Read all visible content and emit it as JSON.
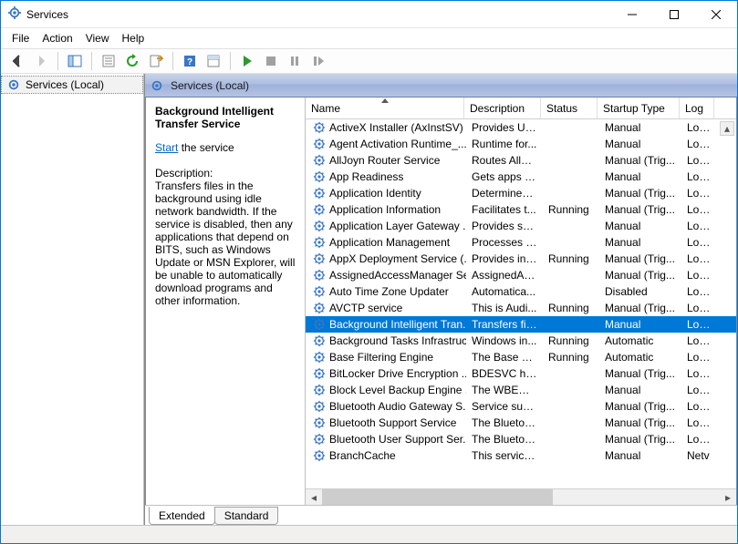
{
  "window": {
    "title": "Services"
  },
  "menu": [
    "File",
    "Action",
    "View",
    "Help"
  ],
  "tree": {
    "node": "Services (Local)"
  },
  "pane": {
    "title": "Services (Local)"
  },
  "detail": {
    "name": "Background Intelligent Transfer Service",
    "action_link": "Start",
    "action_suffix": " the service",
    "description_label": "Description:",
    "description": "Transfers files in the background using idle network bandwidth. If the service is disabled, then any applications that depend on BITS, such as Windows Update or MSN Explorer, will be unable to automatically download programs and other information."
  },
  "columns": [
    "Name",
    "Description",
    "Status",
    "Startup Type",
    "Log"
  ],
  "tabs": [
    "Extended",
    "Standard"
  ],
  "selected_index": 12,
  "services": [
    {
      "name": "ActiveX Installer (AxInstSV)",
      "desc": "Provides Us...",
      "status": "",
      "startup": "Manual",
      "logon": "Loca"
    },
    {
      "name": "Agent Activation Runtime_...",
      "desc": "Runtime for...",
      "status": "",
      "startup": "Manual",
      "logon": "Loca"
    },
    {
      "name": "AllJoyn Router Service",
      "desc": "Routes AllJo...",
      "status": "",
      "startup": "Manual (Trig...",
      "logon": "Loca"
    },
    {
      "name": "App Readiness",
      "desc": "Gets apps re...",
      "status": "",
      "startup": "Manual",
      "logon": "Loca"
    },
    {
      "name": "Application Identity",
      "desc": "Determines ...",
      "status": "",
      "startup": "Manual (Trig...",
      "logon": "Loca"
    },
    {
      "name": "Application Information",
      "desc": "Facilitates t...",
      "status": "Running",
      "startup": "Manual (Trig...",
      "logon": "Loca"
    },
    {
      "name": "Application Layer Gateway ...",
      "desc": "Provides su...",
      "status": "",
      "startup": "Manual",
      "logon": "Loca"
    },
    {
      "name": "Application Management",
      "desc": "Processes in...",
      "status": "",
      "startup": "Manual",
      "logon": "Loca"
    },
    {
      "name": "AppX Deployment Service (...",
      "desc": "Provides inf...",
      "status": "Running",
      "startup": "Manual (Trig...",
      "logon": "Loca"
    },
    {
      "name": "AssignedAccessManager Se...",
      "desc": "AssignedAc...",
      "status": "",
      "startup": "Manual (Trig...",
      "logon": "Loca"
    },
    {
      "name": "Auto Time Zone Updater",
      "desc": "Automatica...",
      "status": "",
      "startup": "Disabled",
      "logon": "Loca"
    },
    {
      "name": "AVCTP service",
      "desc": "This is Audi...",
      "status": "Running",
      "startup": "Manual (Trig...",
      "logon": "Loca"
    },
    {
      "name": "Background Intelligent Tran...",
      "desc": "Transfers fil...",
      "status": "",
      "startup": "Manual",
      "logon": "Loca"
    },
    {
      "name": "Background Tasks Infrastruc...",
      "desc": "Windows in...",
      "status": "Running",
      "startup": "Automatic",
      "logon": "Loca"
    },
    {
      "name": "Base Filtering Engine",
      "desc": "The Base Fil...",
      "status": "Running",
      "startup": "Automatic",
      "logon": "Loca"
    },
    {
      "name": "BitLocker Drive Encryption ...",
      "desc": "BDESVC hos...",
      "status": "",
      "startup": "Manual (Trig...",
      "logon": "Loca"
    },
    {
      "name": "Block Level Backup Engine ...",
      "desc": "The WBENG...",
      "status": "",
      "startup": "Manual",
      "logon": "Loca"
    },
    {
      "name": "Bluetooth Audio Gateway S...",
      "desc": "Service sup...",
      "status": "",
      "startup": "Manual (Trig...",
      "logon": "Loca"
    },
    {
      "name": "Bluetooth Support Service",
      "desc": "The Bluetoo...",
      "status": "",
      "startup": "Manual (Trig...",
      "logon": "Loca"
    },
    {
      "name": "Bluetooth User Support Ser...",
      "desc": "The Bluetoo...",
      "status": "",
      "startup": "Manual (Trig...",
      "logon": "Loca"
    },
    {
      "name": "BranchCache",
      "desc": "This service ...",
      "status": "",
      "startup": "Manual",
      "logon": "Netv"
    }
  ]
}
